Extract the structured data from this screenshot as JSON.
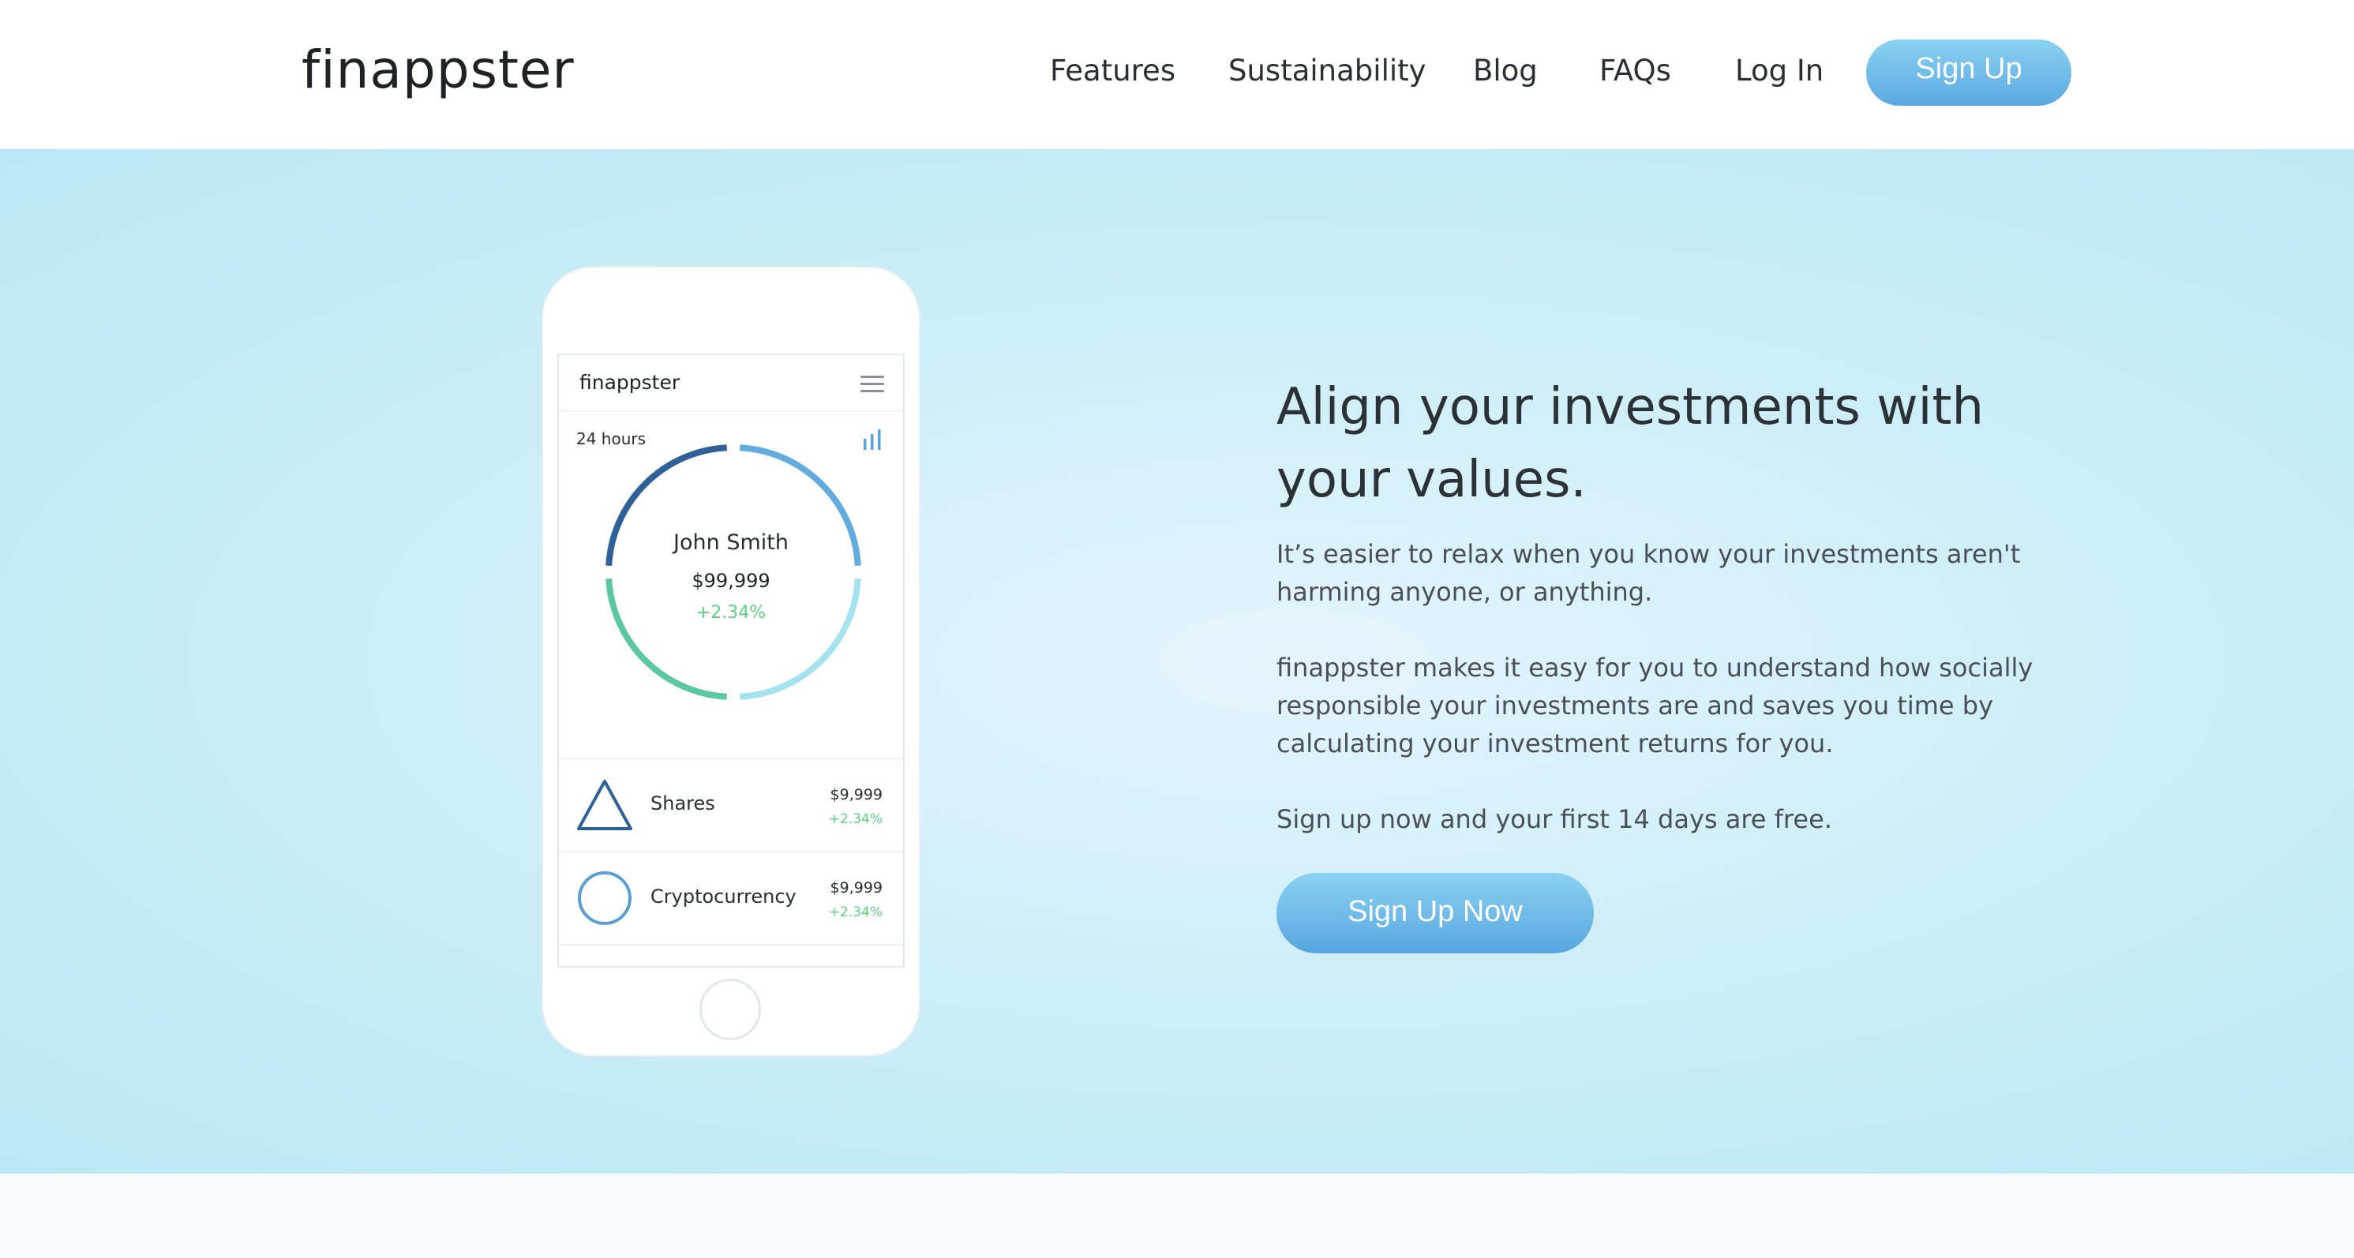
{
  "header": {
    "logo": "finappster",
    "nav": [
      "Features",
      "Sustainability",
      "Blog",
      "FAQs",
      "Log In"
    ],
    "signup_label": "Sign Up"
  },
  "phone": {
    "app_logo": "finappster",
    "menu_icon": "hamburger-menu-icon",
    "period_label": "24 hours",
    "chart_icon": "bar-chart-icon",
    "account_name": "John Smith",
    "account_value": "$99,999",
    "account_change": "+2.34%",
    "ring_colors": [
      "#2f6199",
      "#5aa6dc",
      "#9fe0ee",
      "#5cc7a0"
    ],
    "holdings": [
      {
        "label": "Shares",
        "value": "$9,999",
        "change": "+2.34%",
        "icon": "triangle-icon"
      },
      {
        "label": "Cryptocurrency",
        "value": "$9,999",
        "change": "+2.34%",
        "icon": "circle-icon"
      }
    ]
  },
  "hero": {
    "headline": "Align your investments with your values.",
    "para1": "It’s easier to relax when you know your investments aren't harming anyone, or anything.",
    "para2": "finappster makes it easy for you to understand how socially responsible your investments are and saves you time by calculating your investment returns for you.",
    "para3": "Sign up now and your first 14 days are free.",
    "cta_label": "Sign Up Now"
  },
  "colors": {
    "accent": "#5aa8e2",
    "positive": "#5cd07e",
    "hero_bg": "#c8ecf8"
  }
}
